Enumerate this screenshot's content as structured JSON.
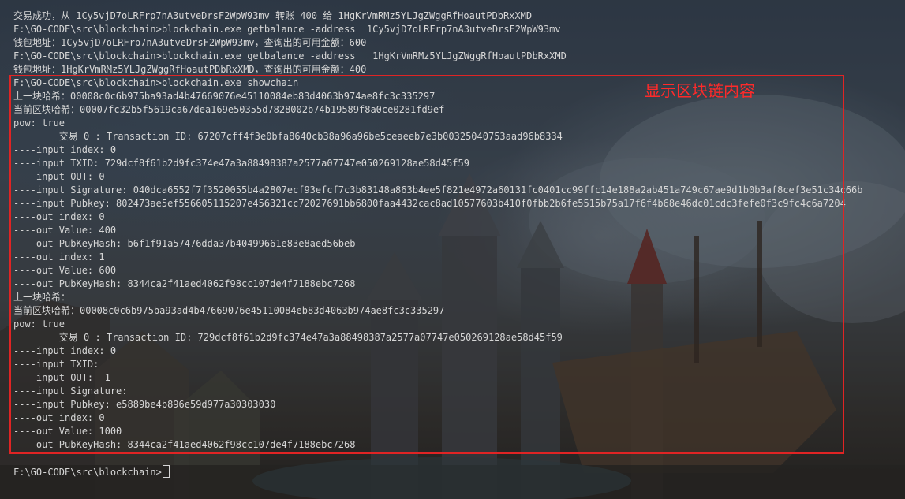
{
  "terminal": {
    "lines": [
      "交易成功，从 1Cy5vjD7oLRFrp7nA3utveDrsF2WpW93mv 转账 400 给 1HgKrVmRMz5YLJgZWggRfHoautPDbRxXMD",
      "F:\\GO-CODE\\src\\blockchain>blockchain.exe getbalance -address  1Cy5vjD7oLRFrp7nA3utveDrsF2WpW93mv",
      "钱包地址：1Cy5vjD7oLRFrp7nA3utveDrsF2WpW93mv，查询出的可用金额：600",
      "F:\\GO-CODE\\src\\blockchain>blockchain.exe getbalance -address   1HgKrVmRMz5YLJgZWggRfHoautPDbRxXMD",
      "钱包地址：1HgKrVmRMz5YLJgZWggRfHoautPDbRxXMD，查询出的可用金额：400",
      "F:\\GO-CODE\\src\\blockchain>blockchain.exe showchain",
      "上一块哈希：00008c0c6b975ba93ad4b47669076e45110084eb83d4063b974ae8fc3c335297",
      "当前区块哈希：00007fc32b5f5619ca67dea169e50355d7828002b74b19589f8a0ce0281fd9ef",
      "pow: true",
      "        交易 0 : Transaction ID: 67207cff4f3e0bfa8640cb38a96a96be5ceaeeb7e3b00325040753aad96b8334",
      "----input index: 0",
      "----input TXID: 729dcf8f61b2d9fc374e47a3a88498387a2577a07747e050269128ae58d45f59",
      "----input OUT: 0",
      "----input Signature: 040dca6552f7f3520055b4a2807ecf93efcf7c3b83148a863b4ee5f821e4972a60131fc0401cc99ffc14e188a2ab451a749c67ae9d1b0b3af8cef3e51c34c66b",
      "----input Pubkey: 802473ae5ef556605115207e456321cc72027691bb6800faa4432cac8ad10577603b410f0fbb2b6fe5515b75a17f6f4b68e46dc01cdc3fefe0f3c9fc4c6a7204",
      "----out index: 0",
      "----out Value: 400",
      "----out PubKeyHash: b6f1f91a57476dda37b40499661e83e8aed56beb",
      "----out index: 1",
      "----out Value: 600",
      "----out PubKeyHash: 8344ca2f41aed4062f98cc107de4f7188ebc7268",
      "上一块哈希：",
      "当前区块哈希：00008c0c6b975ba93ad4b47669076e45110084eb83d4063b974ae8fc3c335297",
      "pow: true",
      "        交易 0 : Transaction ID: 729dcf8f61b2d9fc374e47a3a88498387a2577a07747e050269128ae58d45f59",
      "----input index: 0",
      "----input TXID:",
      "----input OUT: -1",
      "----input Signature:",
      "----input Pubkey: e5889be4b896e59d977a30303030",
      "----out index: 0",
      "----out Value: 1000",
      "----out PubKeyHash: 8344ca2f41aed4062f98cc107de4f7188ebc7268"
    ],
    "prompt": "F:\\GO-CODE\\src\\blockchain>"
  },
  "annotation": {
    "label": "显示区块链内容",
    "color": "#ff2a2a"
  }
}
